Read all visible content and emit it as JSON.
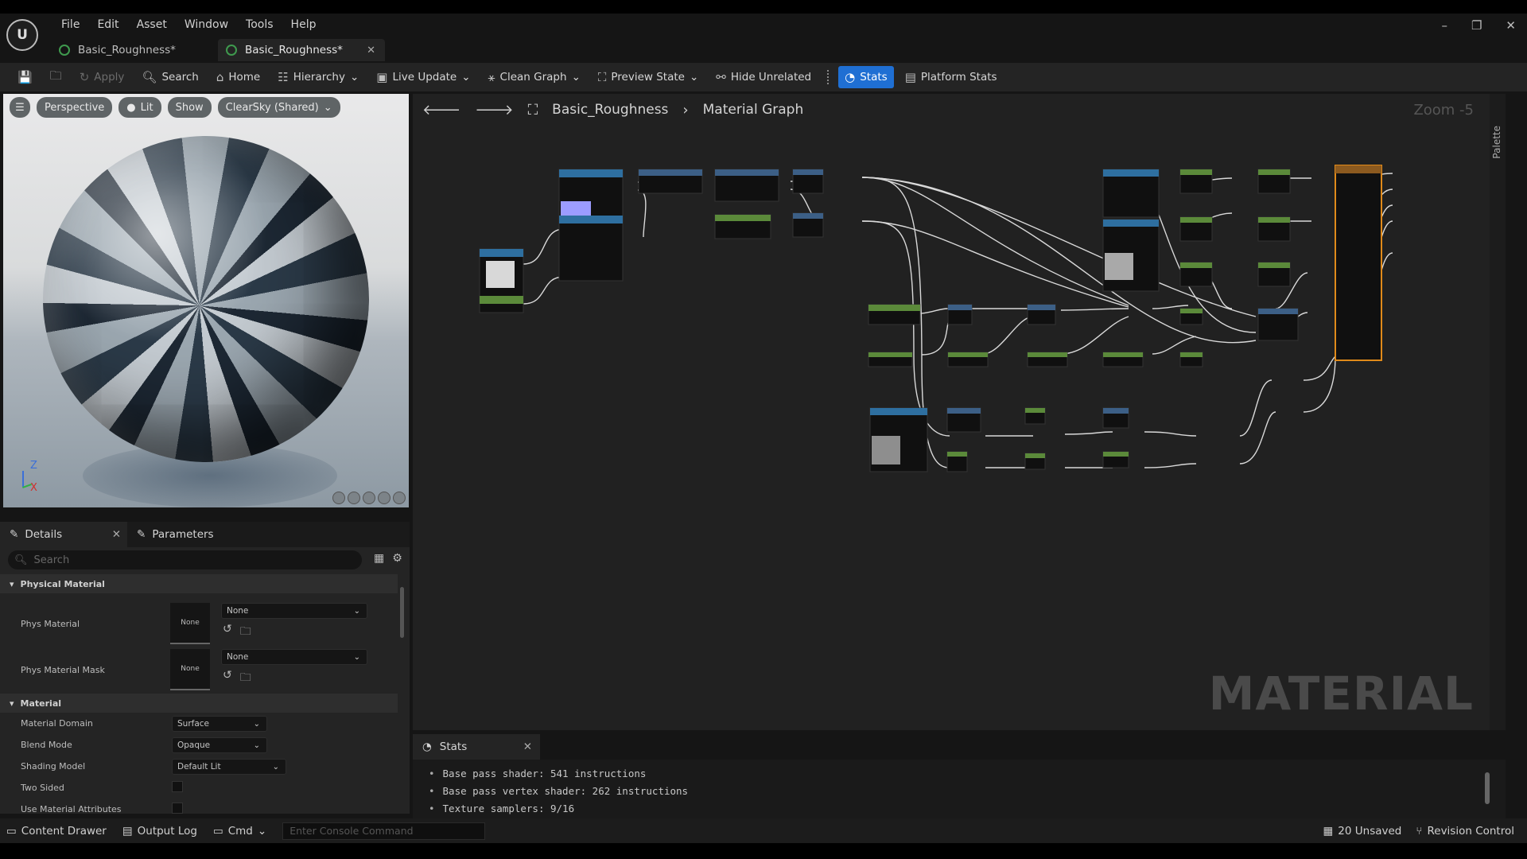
{
  "menu": [
    "File",
    "Edit",
    "Asset",
    "Window",
    "Tools",
    "Help"
  ],
  "logo_text": "U",
  "tabs": [
    {
      "label": "Basic_Roughness*",
      "active": false
    },
    {
      "label": "Basic_Roughness*",
      "active": true
    }
  ],
  "toolbar": {
    "apply": "Apply",
    "search": "Search",
    "home": "Home",
    "hierarchy": "Hierarchy",
    "live_update": "Live Update",
    "clean_graph": "Clean Graph",
    "preview_state": "Preview State",
    "hide_unrelated": "Hide Unrelated",
    "stats": "Stats",
    "platform_stats": "Platform Stats"
  },
  "viewport": {
    "perspective": "Perspective",
    "lit": "Lit",
    "show": "Show",
    "sky": "ClearSky (Shared)",
    "axis_z": "Z",
    "axis_x": "X"
  },
  "details": {
    "tab_details": "Details",
    "tab_parameters": "Parameters",
    "search_placeholder": "Search",
    "section_physical": "Physical Material",
    "phys_material_label": "Phys Material",
    "phys_material_thumb": "None",
    "phys_material_value": "None",
    "phys_mask_label": "Phys Material Mask",
    "phys_mask_thumb": "None",
    "phys_mask_value": "None",
    "section_material": "Material",
    "domain_label": "Material Domain",
    "domain_value": "Surface",
    "blend_label": "Blend Mode",
    "blend_value": "Opaque",
    "shading_label": "Shading Model",
    "shading_value": "Default Lit",
    "two_sided_label": "Two Sided",
    "use_attr_label": "Use Material Attributes"
  },
  "graph": {
    "asset": "Basic_Roughness",
    "view": "Material Graph",
    "zoom": "Zoom -5",
    "palette": "Palette",
    "watermark": "MATERIAL"
  },
  "stats": {
    "tab": "Stats",
    "lines": [
      "Base pass shader: 541 instructions",
      "Base pass vertex shader: 262 instructions",
      "Texture samplers: 9/16"
    ]
  },
  "statusbar": {
    "content_drawer": "Content Drawer",
    "output_log": "Output Log",
    "cmd": "Cmd",
    "console_placeholder": "Enter Console Command",
    "unsaved": "20 Unsaved",
    "revision": "Revision Control"
  }
}
